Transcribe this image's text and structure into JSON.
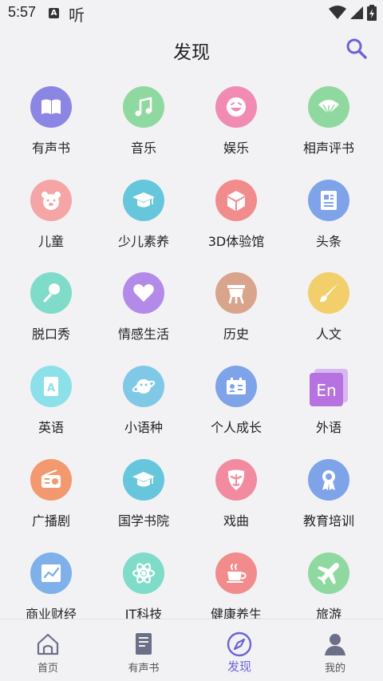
{
  "status_bar": {
    "time": "5:57",
    "notif_letter": "A",
    "app_name": "听"
  },
  "header": {
    "title": "发现"
  },
  "categories": [
    {
      "label": "有声书",
      "icon": "book-icon",
      "color": "#8b85e3"
    },
    {
      "label": "音乐",
      "icon": "music-note-icon",
      "color": "#8fd9a0"
    },
    {
      "label": "娱乐",
      "icon": "smiley-icon",
      "color": "#f28bb3"
    },
    {
      "label": "相声评书",
      "icon": "fan-icon",
      "color": "#8fd9a0"
    },
    {
      "label": "儿童",
      "icon": "bear-icon",
      "color": "#f5a5a5"
    },
    {
      "label": "少儿素养",
      "icon": "graduation-cap-icon",
      "color": "#66c6db"
    },
    {
      "label": "3D体验馆",
      "icon": "cube-icon",
      "color": "#f28c8c"
    },
    {
      "label": "头条",
      "icon": "newspaper-icon",
      "color": "#7fa3e8"
    },
    {
      "label": "脱口秀",
      "icon": "microphone-icon",
      "color": "#7fdcc8"
    },
    {
      "label": "情感生活",
      "icon": "heart-icon",
      "color": "#b48ae8"
    },
    {
      "label": "历史",
      "icon": "ancient-vessel-icon",
      "color": "#d9a48c"
    },
    {
      "label": "人文",
      "icon": "brush-icon",
      "color": "#f2cf6b"
    },
    {
      "label": "英语",
      "icon": "english-book-icon",
      "color": "#8ce0ea"
    },
    {
      "label": "小语种",
      "icon": "planet-icon",
      "color": "#7fc9e6"
    },
    {
      "label": "个人成长",
      "icon": "id-card-icon",
      "color": "#7fa3e8"
    },
    {
      "label": "外语",
      "icon": "en-badge-icon",
      "color": "#b673e0",
      "badge_text": "En"
    },
    {
      "label": "广播剧",
      "icon": "radio-icon",
      "color": "#f2996f"
    },
    {
      "label": "国学书院",
      "icon": "graduation-cap-icon",
      "color": "#66c6db"
    },
    {
      "label": "戏曲",
      "icon": "opera-mask-icon",
      "color": "#f28ba0"
    },
    {
      "label": "教育培训",
      "icon": "award-ribbon-icon",
      "color": "#7fa3e8"
    },
    {
      "label": "商业财经",
      "icon": "chart-icon",
      "color": "#7fb0ea"
    },
    {
      "label": "IT科技",
      "icon": "atom-icon",
      "color": "#7fdcc8"
    },
    {
      "label": "健康养生",
      "icon": "tea-cup-icon",
      "color": "#f28c8c"
    },
    {
      "label": "旅游",
      "icon": "airplane-icon",
      "color": "#8fd9a0"
    }
  ],
  "tabs": [
    {
      "label": "首页",
      "icon": "home-icon",
      "active": false
    },
    {
      "label": "有声书",
      "icon": "audiobook-icon",
      "active": false
    },
    {
      "label": "发现",
      "icon": "compass-icon",
      "active": true
    },
    {
      "label": "我的",
      "icon": "user-icon",
      "active": false
    }
  ],
  "colors": {
    "accent": "#6c63d6",
    "background": "#f2f2f5",
    "icon_gray": "#6b6f87"
  }
}
